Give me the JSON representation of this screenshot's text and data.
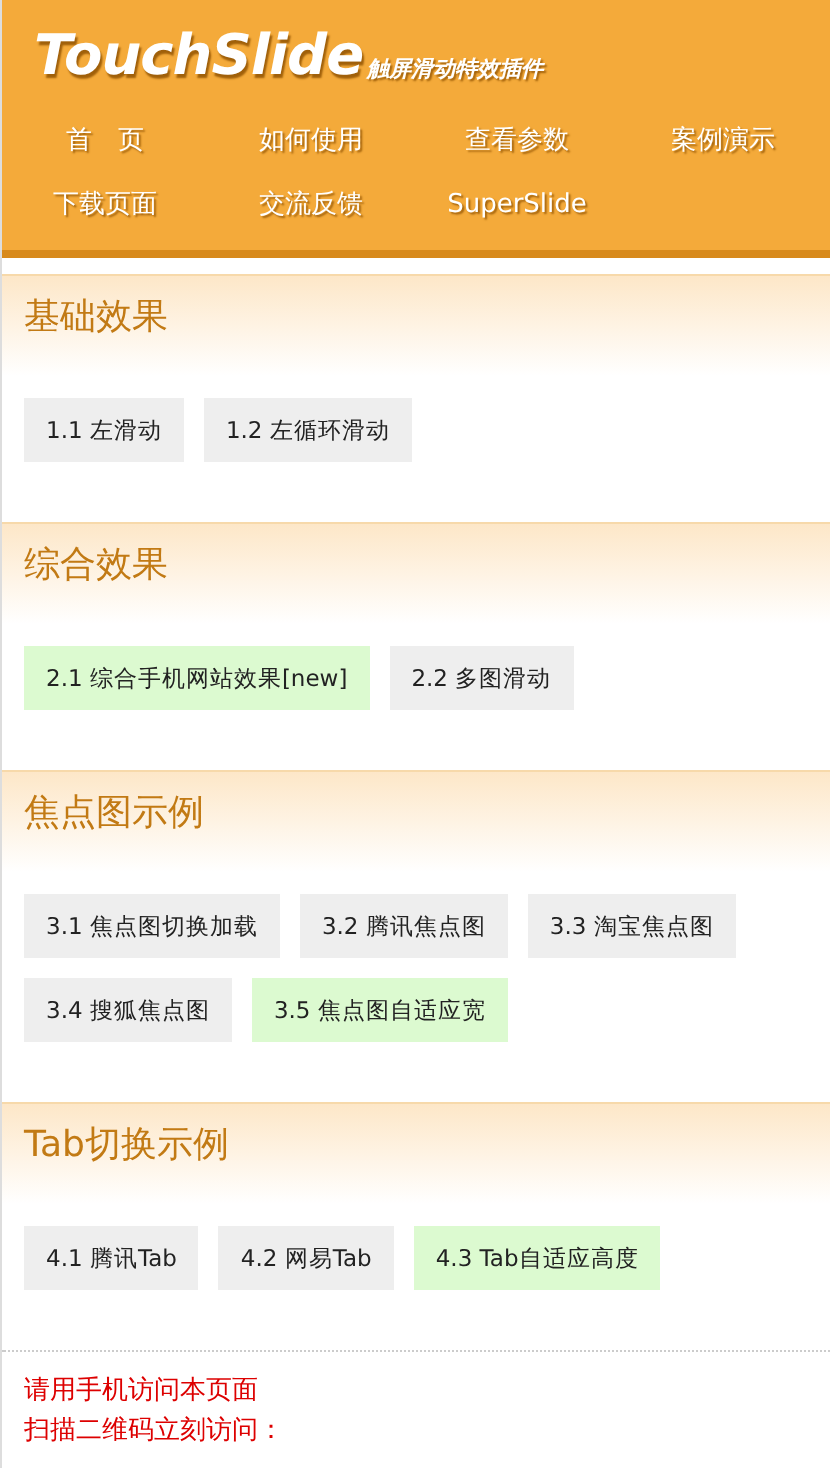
{
  "header": {
    "logo": "TouchSlide",
    "tagline": "触屏滑动特效插件",
    "nav": [
      {
        "label": "首　页"
      },
      {
        "label": "如何使用"
      },
      {
        "label": "查看参数"
      },
      {
        "label": "案例演示"
      },
      {
        "label": "下载页面"
      },
      {
        "label": "交流反馈"
      },
      {
        "label": "SuperSlide"
      }
    ]
  },
  "sections": [
    {
      "title": "基础效果",
      "links": [
        {
          "label": "1.1 左滑动",
          "highlighted": false
        },
        {
          "label": "1.2 左循环滑动",
          "highlighted": false
        }
      ]
    },
    {
      "title": "综合效果",
      "links": [
        {
          "label": "2.1 综合手机网站效果[new]",
          "highlighted": true
        },
        {
          "label": "2.2 多图滑动",
          "highlighted": false
        }
      ]
    },
    {
      "title": "焦点图示例",
      "links": [
        {
          "label": "3.1 焦点图切换加载",
          "highlighted": false
        },
        {
          "label": "3.2 腾讯焦点图",
          "highlighted": false
        },
        {
          "label": "3.3 淘宝焦点图",
          "highlighted": false
        },
        {
          "label": "3.4 搜狐焦点图",
          "highlighted": false
        },
        {
          "label": "3.5 焦点图自适应宽",
          "highlighted": true
        }
      ]
    },
    {
      "title": "Tab切换示例",
      "links": [
        {
          "label": "4.1 腾讯Tab",
          "highlighted": false
        },
        {
          "label": "4.2 网易Tab",
          "highlighted": false
        },
        {
          "label": "4.3 Tab自适应高度",
          "highlighted": true
        }
      ]
    }
  ],
  "footer": {
    "lines": [
      "请用手机访问本页面",
      "扫描二维码立刻访问："
    ]
  }
}
